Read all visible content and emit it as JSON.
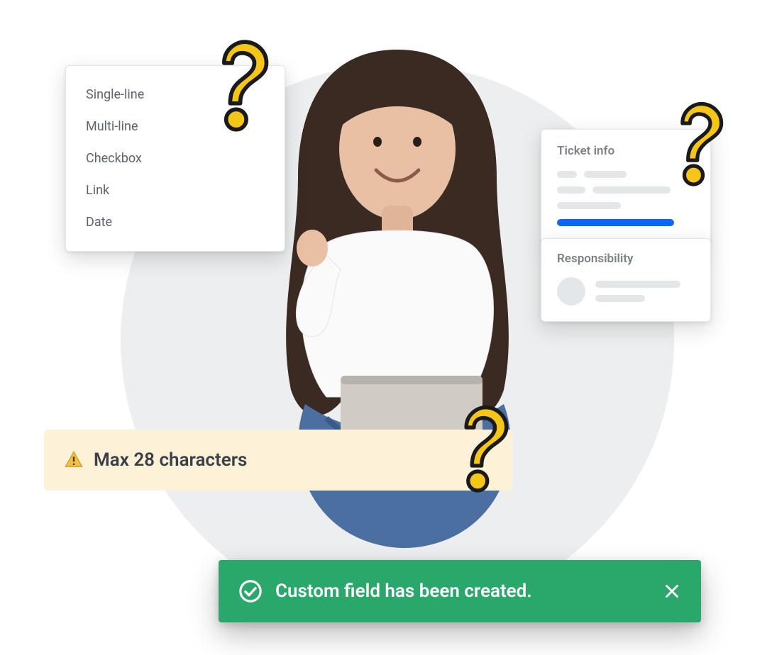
{
  "fieldTypes": {
    "items": [
      {
        "label": "Single-line"
      },
      {
        "label": "Multi-line"
      },
      {
        "label": "Checkbox"
      },
      {
        "label": "Link"
      },
      {
        "label": "Date"
      }
    ]
  },
  "ticketInfo": {
    "title": "Ticket info"
  },
  "responsibility": {
    "title": "Responsibility"
  },
  "warning": {
    "message": "Max 28 characters"
  },
  "toast": {
    "message": "Custom field has been created."
  },
  "colors": {
    "accent": "#0a66ff",
    "success": "#2aa86b",
    "warningBg": "#fdf1d8",
    "questionMark": "#f5c518"
  }
}
